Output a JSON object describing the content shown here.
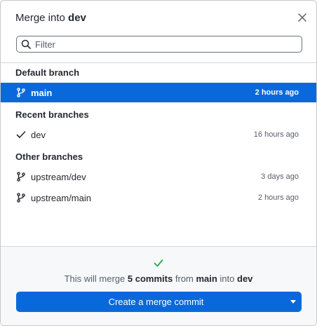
{
  "dialog": {
    "title_prefix": "Merge into",
    "title_branch": "dev",
    "close_icon": "close-icon"
  },
  "filter": {
    "placeholder": "Filter",
    "value": "",
    "icon": "search-icon"
  },
  "sections": {
    "default_label": "Default branch",
    "recent_label": "Recent branches",
    "other_label": "Other branches"
  },
  "branches": {
    "default": [
      {
        "name": "main",
        "time": "2 hours ago",
        "icon": "git-branch-icon",
        "selected": true
      }
    ],
    "recent": [
      {
        "name": "dev",
        "time": "16 hours ago",
        "icon": "checkmark-icon",
        "selected": false
      }
    ],
    "other": [
      {
        "name": "upstream/dev",
        "time": "3 days ago",
        "icon": "git-branch-icon",
        "selected": false
      },
      {
        "name": "upstream/main",
        "time": "2 hours ago",
        "icon": "git-branch-icon",
        "selected": false
      }
    ]
  },
  "footer": {
    "status_icon": "check-icon",
    "msg_prefix": "This will merge",
    "commit_count": "5 commits",
    "msg_from": "from",
    "source_branch": "main",
    "msg_into": "into",
    "target_branch": "dev",
    "button_label": "Create a merge commit",
    "dropdown_icon": "caret-down-icon"
  },
  "colors": {
    "accent": "#0969da",
    "success": "#2da44e",
    "text": "#24292f",
    "muted": "#57606a"
  }
}
